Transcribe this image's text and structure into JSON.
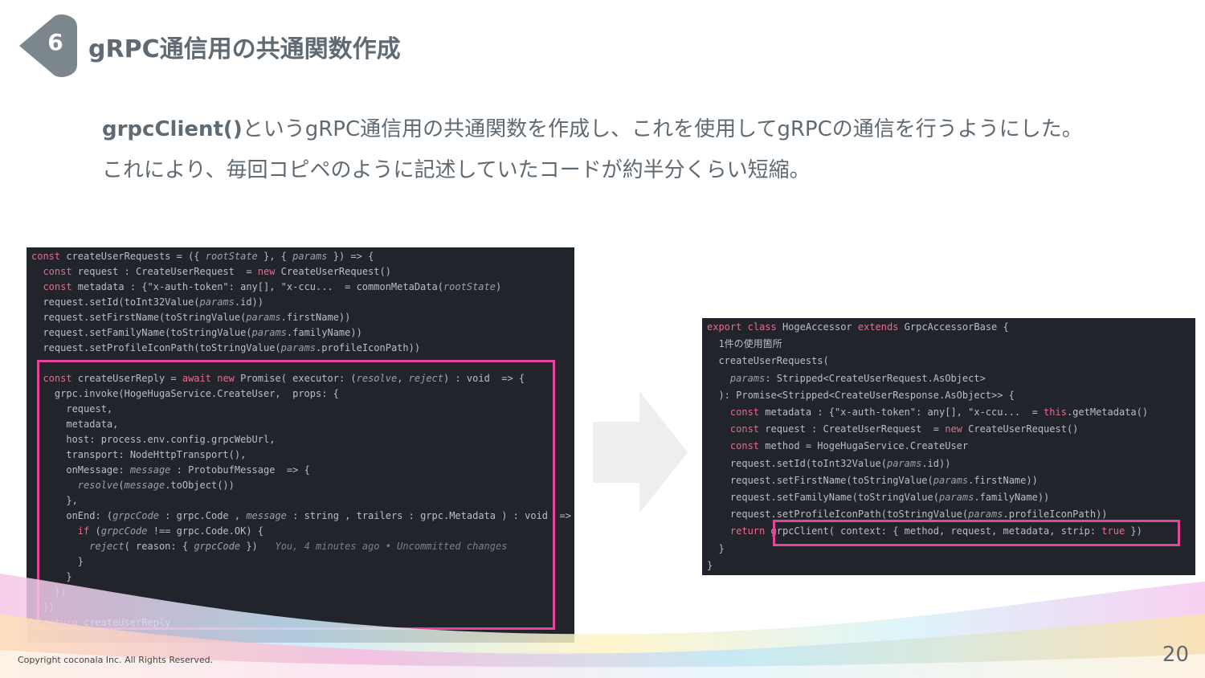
{
  "slide": {
    "number": "6",
    "title": "gRPC通信用の共通関数作成",
    "desc_bold": "grpcClient()",
    "desc_line1_rest": "というgRPC通信用の共通関数を作成し、これを使用してgRPCの通信を行うようにした。",
    "desc_line2": "これにより、毎回コピペのように記述していたコードが約半分くらい短縮。",
    "copyright": "Copyright coconala Inc. All Rights Reserved.",
    "page": "20"
  },
  "colors": {
    "accent": "#e6449a",
    "badge": "#7b868d",
    "text": "#5f6a72",
    "editor_bg": "#21252b",
    "arrow": "#eeeeee"
  },
  "icons": {
    "arrow": "right-arrow-icon",
    "lightbulb": "lightbulb-icon"
  },
  "before_code": {
    "lines": [
      "const createUserRequests = ({ rootState }, { params }) => {",
      "  const request : CreateUserRequest  = new CreateUserRequest()",
      "  const metadata : {\"x-auth-token\": any[], \"x-ccu...  = commonMetaData(rootState)",
      "  request.setId(toInt32Value(params.id))",
      "  request.setFirstName(toStringValue(params.firstName))",
      "  request.setFamilyName(toStringValue(params.familyName))",
      "  request.setProfileIconPath(toStringValue(params.profileIconPath))",
      "",
      "  const createUserReply = await new Promise( executor: (resolve, reject) : void  => {",
      "    grpc.invoke(HogeHugaService.CreateUser,  props: {",
      "      request,",
      "      metadata,",
      "      host: process.env.config.grpcWebUrl,",
      "      transport: NodeHttpTransport(),",
      "      onMessage: message : ProtobufMessage  => {",
      "        resolve(message.toObject())",
      "      },",
      "      onEnd: (grpcCode : grpc.Code , message : string , trailers : grpc.Metadata ) : void  => {",
      "        if (grpcCode !== grpc.Code.OK) {",
      "          reject( reason: { grpcCode })   You, 4 minutes ago • Uncommitted changes",
      "        }",
      "      }",
      "    })",
      "  })",
      "  return createUserReply",
      "}"
    ]
  },
  "after_code": {
    "lines": [
      "export class HogeAccessor extends GrpcAccessorBase {",
      "  1件の使用箇所",
      "  createUserRequests(",
      "    params: Stripped<CreateUserRequest.AsObject>",
      "  ): Promise<Stripped<CreateUserResponse.AsObject>> {",
      "    const metadata : {\"x-auth-token\": any[], \"x-ccu...  = this.getMetadata()",
      "    const request : CreateUserRequest  = new CreateUserRequest()",
      "    const method = HogeHugaService.CreateUser",
      "    request.setId(toInt32Value(params.id))",
      "    request.setFirstName(toStringValue(params.firstName))",
      "    request.setFamilyName(toStringValue(params.familyName))",
      "    request.setProfileIconPath(toStringValue(params.profileIconPath))",
      "    return grpcClient( context: { method, request, metadata, strip: true })",
      "  }",
      "}"
    ]
  }
}
